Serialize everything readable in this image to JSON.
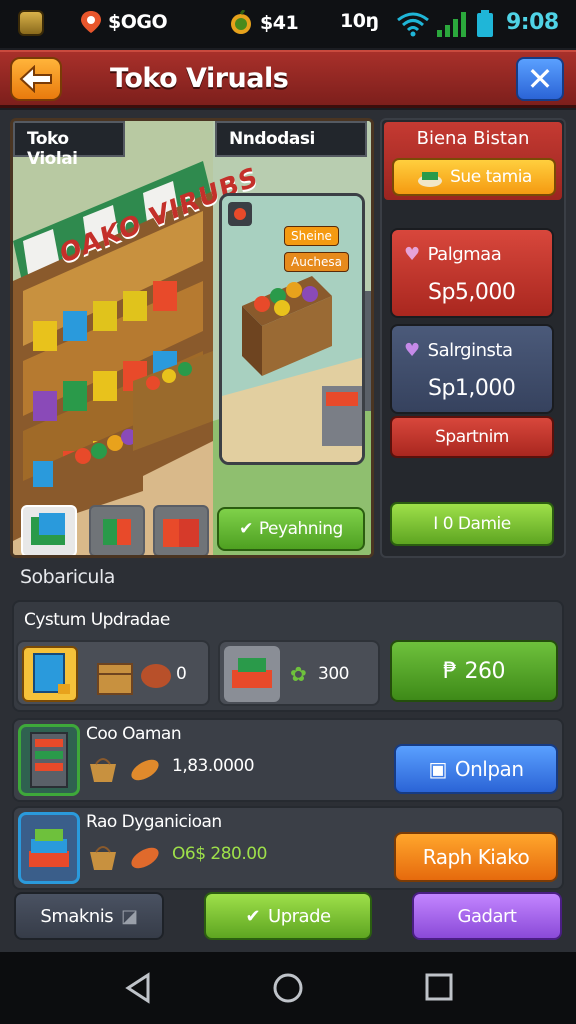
{
  "status_bar": {
    "coins": "$OGO",
    "cash": "$41",
    "signal_text": "10ŋ",
    "time": "9:08"
  },
  "header": {
    "title": "Toko Viruals"
  },
  "store_view": {
    "tab_left": "Toko Violai",
    "tab_right": "Nndodasi",
    "store_sign": "OAKO VIRUBS",
    "mini_btn_1": "Sheine",
    "mini_btn_2": "Auchesa",
    "action_button": "Peyahning"
  },
  "side_panel": {
    "header": "Biena Bistan",
    "save_button": "Sue tamia",
    "card_1": {
      "name": "Palgmaa",
      "value": "Sp5,000"
    },
    "card_2": {
      "name": "Salrginsta",
      "value": "Sp1,000"
    },
    "red_button": "Spartnim",
    "green_button": "I 0 Damie"
  },
  "section": {
    "title": "Sobaricula"
  },
  "upgrade": {
    "title": "Cystum Updradae",
    "slot_1_value": "0",
    "slot_2_value": "300",
    "buy_button": "260"
  },
  "rows": [
    {
      "title": "Coo Oaman",
      "value": "1,83.0000",
      "button": "Onlpan"
    },
    {
      "title": "Rao Dyganicioan",
      "value": "O6$ 280.00",
      "button": "Raph Kiako"
    }
  ],
  "bottom_buttons": {
    "left": "Smaknis",
    "middle": "Uprade",
    "right": "Gadart"
  },
  "colors": {
    "title_bar": "#a8302a",
    "accent_green": "#6ec13c",
    "accent_orange": "#f59a11",
    "accent_blue": "#2b64d6",
    "accent_purple": "#a65ee0"
  }
}
